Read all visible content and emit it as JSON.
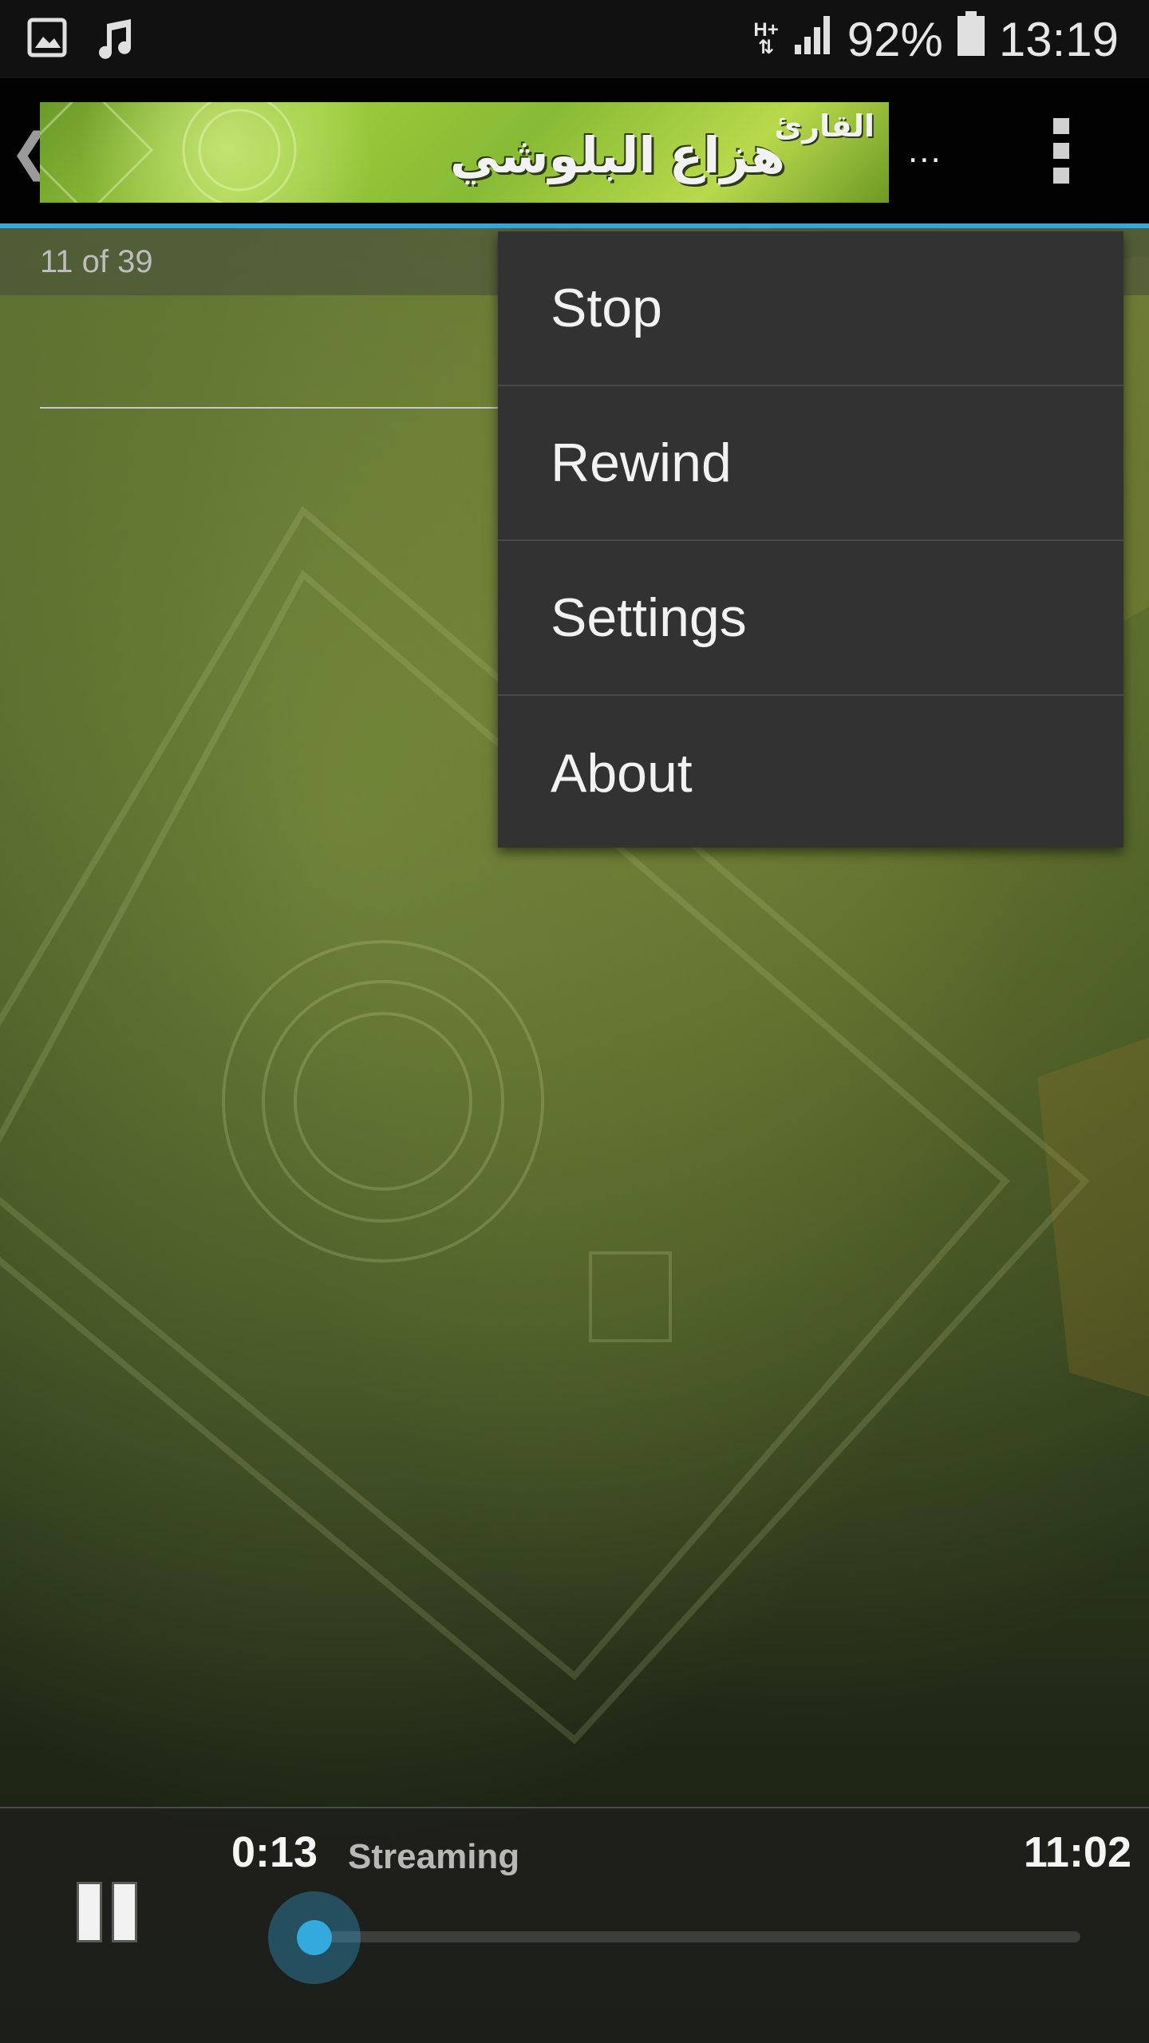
{
  "status_bar": {
    "network": "H+",
    "battery_percent": "92%",
    "time": "13:19",
    "icons": [
      "image-icon",
      "music-note-icon",
      "data-arrows-icon",
      "signal-icon",
      "battery-icon"
    ]
  },
  "header": {
    "banner_prefix": "القارئ",
    "banner_title": "هزاع البلوشي",
    "ellipsis": "..."
  },
  "playlist": {
    "counter": "11 of 39"
  },
  "menu": {
    "items": [
      {
        "label": "Stop"
      },
      {
        "label": "Rewind"
      },
      {
        "label": "Settings"
      },
      {
        "label": "About"
      }
    ]
  },
  "player": {
    "elapsed": "0:13",
    "status": "Streaming",
    "duration": "11:02",
    "progress": 0.02
  },
  "colors": {
    "accent": "#33a9dc",
    "menu_bg": "#323232",
    "status_bg": "#111111"
  }
}
